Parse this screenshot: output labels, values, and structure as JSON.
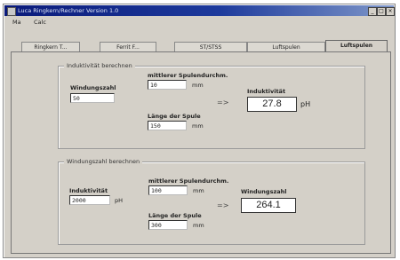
{
  "window": {
    "title": "Luca Ringkern/Rechner Version 1.0",
    "controls": {
      "minimize": "_",
      "maximize": "□",
      "close": "×"
    }
  },
  "menu": [
    "Ma",
    "Calc"
  ],
  "tabs": [
    "Ringkern T...",
    "Ferrit F...",
    "ST/STSS",
    "Luftspulen",
    "Luftspulen"
  ],
  "active_tab": 4,
  "inductance_group": {
    "title": "Induktivität berechnen",
    "turns_label": "Windungszahl",
    "turns_value": "50",
    "mean_diameter_label": "mittlerer Spulendurchm.",
    "mean_diameter_value": "10",
    "mean_diameter_unit": "mm",
    "coil_length_label": "Länge der Spule",
    "coil_length_value": "150",
    "coil_length_unit": "mm",
    "arrow": "=>",
    "result_label": "Induktivität",
    "result_value": "27.8",
    "result_unit": "pH"
  },
  "turns_group": {
    "title": "Windungszahl berechnen",
    "inductance_label": "Induktivität",
    "inductance_value": "2000",
    "inductance_unit": "pH",
    "mean_diameter_label": "mittlerer Spulendurchm.",
    "mean_diameter_value": "100",
    "mean_diameter_unit": "mm",
    "coil_length_label": "Länge der Spule",
    "coil_length_value": "300",
    "coil_length_unit": "mm",
    "arrow": "=>",
    "result_label": "Windungszahl",
    "result_value": "264.1"
  }
}
